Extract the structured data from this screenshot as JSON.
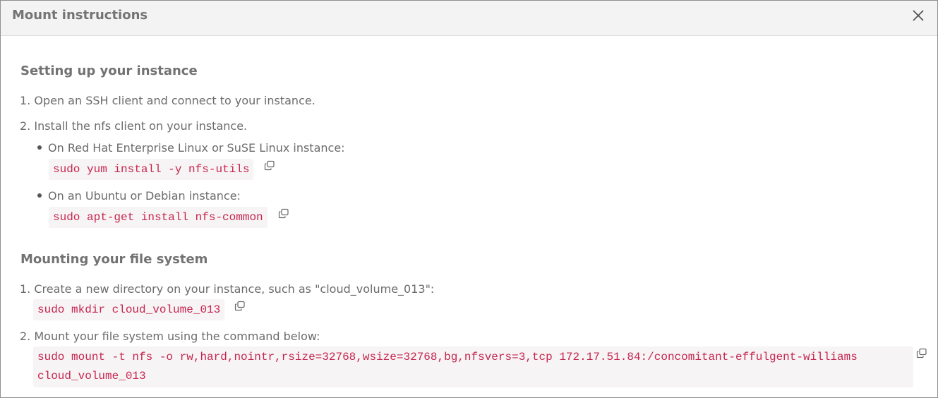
{
  "dialog": {
    "title": "Mount instructions",
    "close_icon": "close-icon"
  },
  "setup": {
    "heading": "Setting up your instance",
    "step1": "1. Open an SSH client and connect to your instance.",
    "step2": "2. Install the nfs client on your instance.",
    "bullet_rhel": "On Red Hat Enterprise Linux or SuSE Linux instance:",
    "cmd_rhel": "sudo yum install -y nfs-utils",
    "bullet_ubuntu": "On an Ubuntu or Debian instance:",
    "cmd_ubuntu": "sudo apt-get install nfs-common"
  },
  "mounting": {
    "heading": "Mounting your file system",
    "step1": "1. Create a new directory on your instance, such as \"cloud_volume_013\":",
    "cmd_mkdir": "sudo mkdir cloud_volume_013",
    "step2": "2. Mount your file system using the command below:",
    "cmd_mount": "sudo mount -t nfs -o rw,hard,nointr,rsize=32768,wsize=32768,bg,nfsvers=3,tcp 172.17.51.84:/concomitant-effulgent-williams cloud_volume_013"
  },
  "icons": {
    "copy": "copy-icon"
  },
  "colors": {
    "code_text": "#c7254e",
    "code_bg": "#f6f4f5",
    "header_bg": "#f3f3f3"
  }
}
